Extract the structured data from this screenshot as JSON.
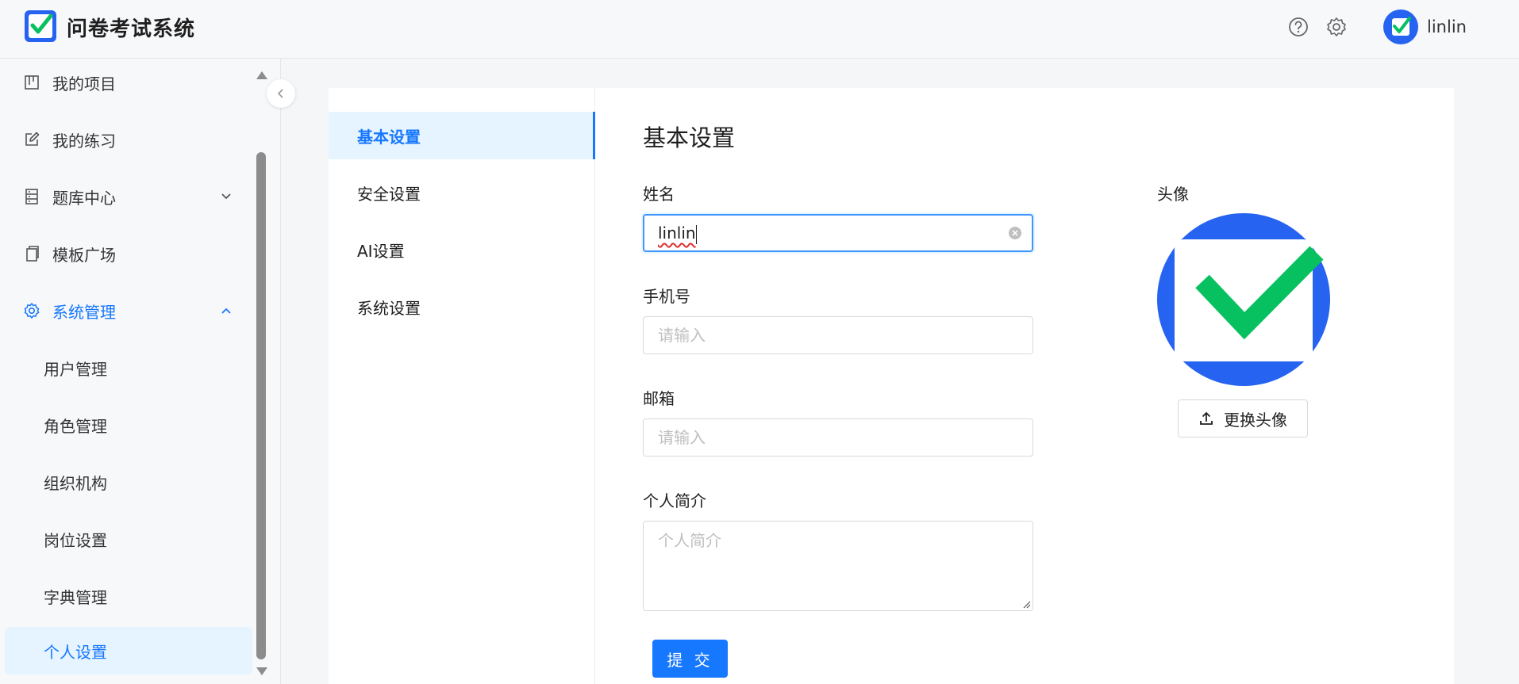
{
  "header": {
    "app_title": "问卷考试系统",
    "help_icon": "question-circle-icon",
    "settings_icon": "gear-icon",
    "user_name": "linlin",
    "brand_blue": "#2563f0",
    "brand_green": "#07c160"
  },
  "sidebar": {
    "items": [
      {
        "label": "我的项目",
        "icon": "project-icon"
      },
      {
        "label": "我的练习",
        "icon": "edit-icon"
      },
      {
        "label": "题库中心",
        "icon": "database-icon"
      },
      {
        "label": "模板广场",
        "icon": "copy-icon"
      },
      {
        "label": "系统管理",
        "icon": "gear-icon"
      }
    ],
    "sub_items": [
      {
        "label": "用户管理"
      },
      {
        "label": "角色管理"
      },
      {
        "label": "组织机构"
      },
      {
        "label": "岗位设置"
      },
      {
        "label": "字典管理"
      },
      {
        "label": "个人设置"
      }
    ],
    "active_sub": "个人设置",
    "accent": "#1677ff"
  },
  "settings_nav": {
    "items": [
      {
        "label": "基本设置"
      },
      {
        "label": "安全设置"
      },
      {
        "label": "AI设置"
      },
      {
        "label": "系统设置"
      }
    ],
    "active": "基本设置"
  },
  "form": {
    "section_title": "基本设置",
    "name_label": "姓名",
    "name_value": "linlin",
    "phone_label": "手机号",
    "phone_placeholder": "请输入",
    "email_label": "邮箱",
    "email_placeholder": "请输入",
    "bio_label": "个人简介",
    "bio_placeholder": "个人简介",
    "submit_label": "提 交"
  },
  "avatar": {
    "label": "头像",
    "change_button": "更换头像"
  }
}
